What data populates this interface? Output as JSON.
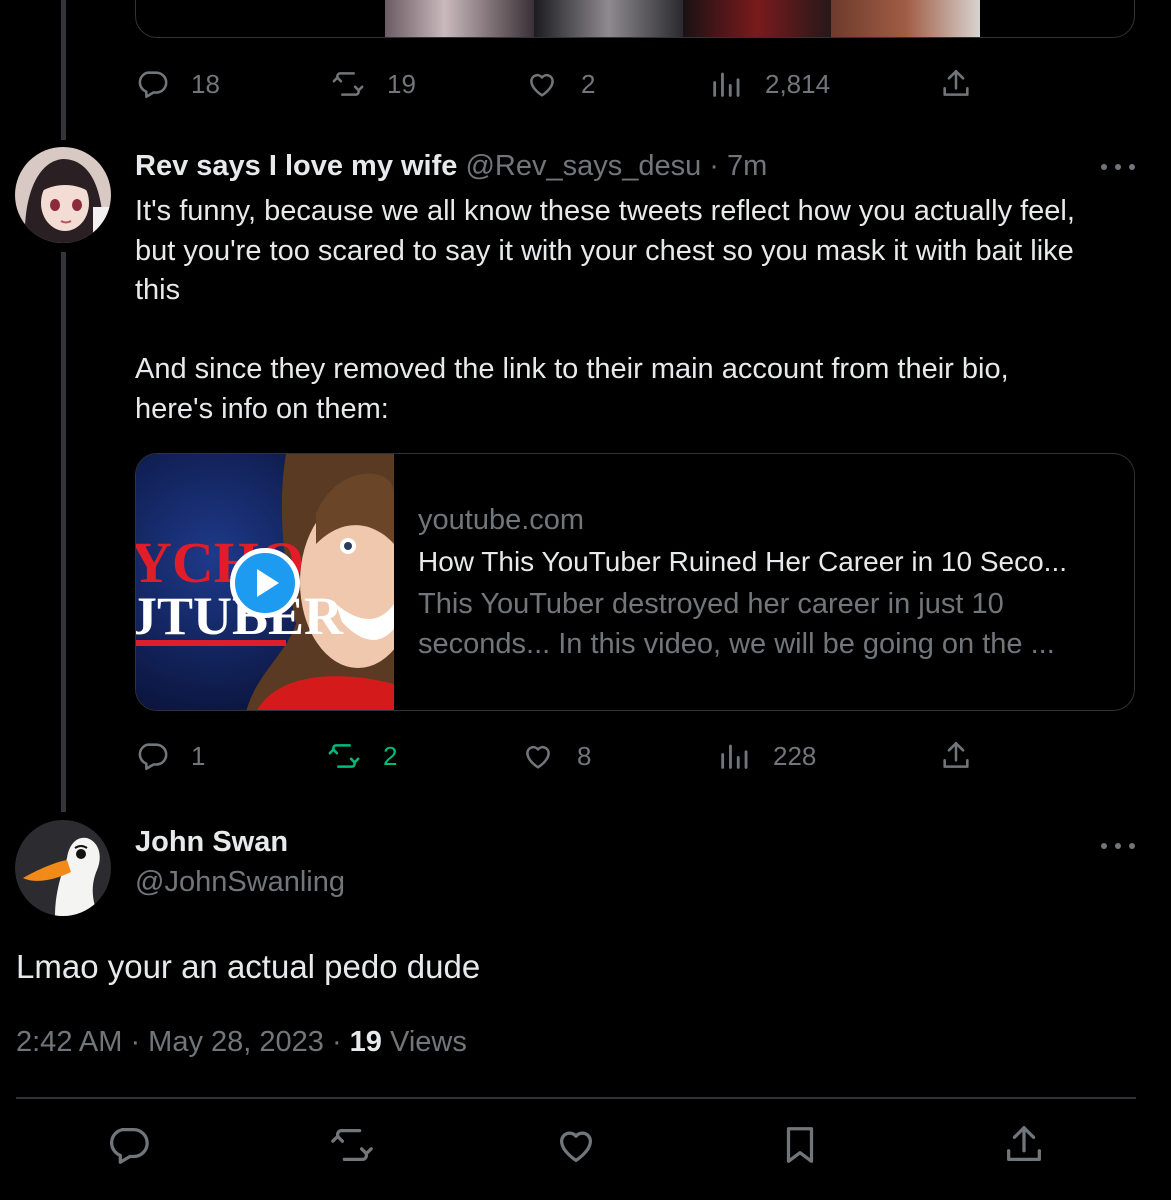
{
  "colors": {
    "background": "#000000",
    "text": "#e7e9ea",
    "muted": "#71767b",
    "border": "#2f3336",
    "retweet_active": "#00ba7c",
    "play": "#1d9bf0"
  },
  "prev_tweet": {
    "stats": {
      "replies": "18",
      "retweets": "19",
      "likes": "2",
      "views": "2,814"
    }
  },
  "reply_tweet": {
    "author_name": "Rev says I love my wife",
    "meta": "@Rev_says_desu · 7m",
    "paragraph_1": [
      "It's funny, because we all know these tweets reflect how you actually feel,",
      "but you're too scared to say it with your chest so you mask it with bait like",
      "this"
    ],
    "paragraph_2": [
      "And since they removed the link to their main account from their bio,",
      "here's info on them:"
    ],
    "link_card": {
      "domain": "youtube.com",
      "title": "How This YouTuber Ruined Her Career in 10 Seco...",
      "description_1": "This YouTuber destroyed her career in just 10",
      "description_2": "seconds... In this video, we will be going on the ...",
      "thumbnail_text_1": "YCHO",
      "thumbnail_text_2": "JTUBER"
    },
    "stats": {
      "replies": "1",
      "retweets": "2",
      "likes": "8",
      "views": "228"
    }
  },
  "focus_tweet": {
    "author_name": "John Swan",
    "handle": "@JohnSwanling",
    "text": "Lmao your an actual pedo dude",
    "timestamp": "2:42 AM · May 28, 2023 · ",
    "views_count": "19",
    "views_label": " Views"
  }
}
